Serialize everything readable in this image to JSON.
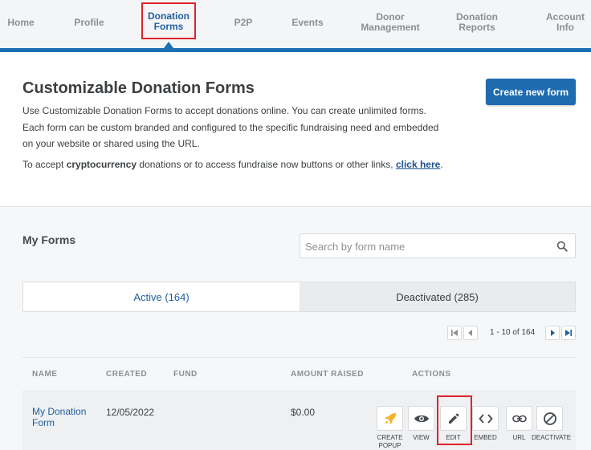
{
  "nav": {
    "items": [
      {
        "label": "Home"
      },
      {
        "label": "Profile"
      },
      {
        "label": "Donation\nForms"
      },
      {
        "label": "P2P"
      },
      {
        "label": "Events"
      },
      {
        "label": "Donor\nManagement"
      },
      {
        "label": "Donation\nReports"
      },
      {
        "label": "Account\nInfo"
      }
    ],
    "active": "Donation Forms"
  },
  "header": {
    "title": "Customizable Donation Forms",
    "description": "Use Customizable Donation Forms to accept donations online. You can create unlimited forms. Each form can be custom branded and configured to the specific fundraising need and embedded on your website or shared using the URL.",
    "crypto_prefix": "To accept ",
    "crypto_bold": "cryptocurrency",
    "crypto_middle": " donations or to access fundraise now buttons or other links, ",
    "crypto_link": "click here",
    "crypto_suffix": ".",
    "create_button": "Create new form"
  },
  "forms": {
    "heading": "My Forms",
    "search_placeholder": "Search by form name",
    "tabs": [
      {
        "label": "Active (164)",
        "active": true
      },
      {
        "label": "Deactivated (285)",
        "active": false
      }
    ],
    "pagination": "1 - 10 of 164",
    "columns": [
      "NAME",
      "CREATED",
      "FUND",
      "AMOUNT RAISED",
      "ACTIONS"
    ],
    "rows": [
      {
        "name": "My Donation Form",
        "created": "12/05/2022",
        "fund": "",
        "amount": "$0.00"
      }
    ],
    "actions": [
      {
        "label": "CREATE\nPOPUP",
        "icon": "rocket-icon"
      },
      {
        "label": "VIEW",
        "icon": "eye-icon"
      },
      {
        "label": "EDIT",
        "icon": "pencil-icon"
      },
      {
        "label": "EMBED",
        "icon": "code-icon"
      },
      {
        "label": "URL",
        "icon": "link-icon"
      },
      {
        "label": "DEACTIVATE",
        "icon": "ban-icon"
      }
    ]
  },
  "colors": {
    "primary": "#1e6bb0",
    "highlight": "#e0222a",
    "rocket": "#f0b429"
  }
}
